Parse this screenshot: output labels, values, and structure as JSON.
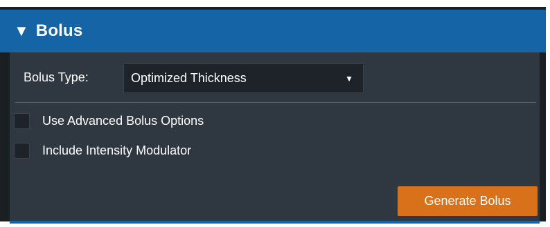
{
  "panel": {
    "header": {
      "collapse_icon": "triangle-down-icon",
      "title": "Bolus"
    },
    "bolus_type": {
      "label": "Bolus Type:",
      "selected": "Optimized Thickness"
    },
    "options": [
      {
        "label": "Use Advanced Bolus Options",
        "checked": false
      },
      {
        "label": "Include Intensity Modulator",
        "checked": false
      }
    ],
    "generate_button": "Generate Bolus"
  },
  "colors": {
    "header_blue": "#1565a6",
    "body_bg": "#2f3740",
    "button_orange": "#d9701a"
  }
}
